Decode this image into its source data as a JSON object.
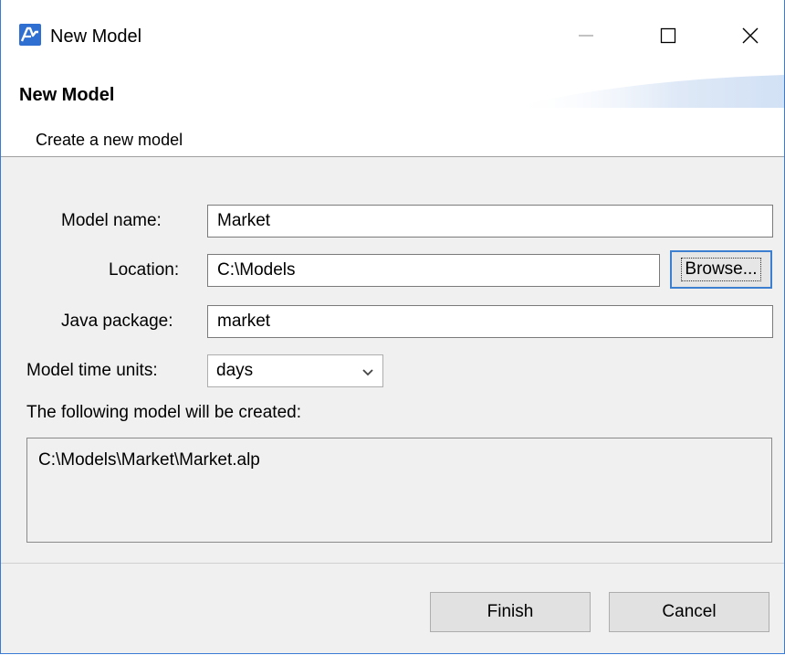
{
  "window": {
    "title": "New Model",
    "icon": "anylogic-logo-icon",
    "controls": {
      "minimize_icon": "minimize-icon",
      "maximize_icon": "maximize-icon",
      "close_icon": "close-icon"
    }
  },
  "banner": {
    "title": "New Model",
    "description": "Create a new model"
  },
  "form": {
    "model_name": {
      "label": "Model name:",
      "value": "Market"
    },
    "location": {
      "label": "Location:",
      "value": "C:\\Models",
      "browse_label": "Browse..."
    },
    "java_package": {
      "label": "Java package:",
      "value": "market"
    },
    "time_units": {
      "label": "Model time units:",
      "selected": "days",
      "arrow_icon": "chevron-down-icon"
    }
  },
  "preview": {
    "label": "The following model will be created:",
    "path": "C:\\Models\\Market\\Market.alp"
  },
  "buttons": {
    "finish": "Finish",
    "cancel": "Cancel"
  },
  "colors": {
    "accent": "#3c7fd0",
    "panel_bg": "#f0f0f0",
    "logo_blue": "#2f6fd1"
  }
}
